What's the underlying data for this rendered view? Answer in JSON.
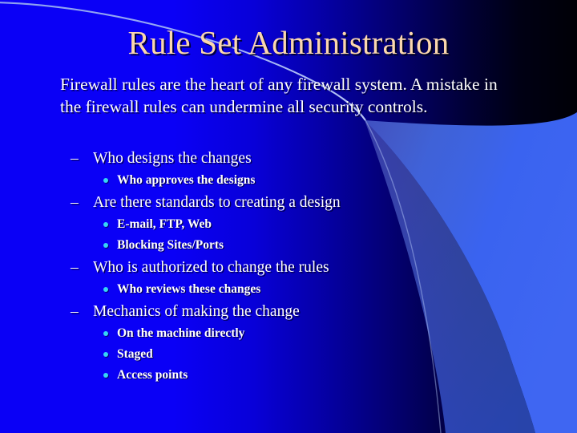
{
  "slide": {
    "title": "Rule Set Administration",
    "body_paragraph": "Firewall rules are the heart of any firewall system. A mistake in the firewall rules can undermine all security controls.",
    "level1_dash": "–",
    "bullets": [
      {
        "level": 1,
        "text": "Who designs the changes"
      },
      {
        "level": 2,
        "text": "Who approves the designs"
      },
      {
        "level": 1,
        "text": "Are there standards to creating a design"
      },
      {
        "level": 2,
        "text": "E-mail, FTP, Web"
      },
      {
        "level": 2,
        "text": "Blocking Sites/Ports"
      },
      {
        "level": 1,
        "text": "Who is authorized to change the rules"
      },
      {
        "level": 2,
        "text": "Who reviews these changes"
      },
      {
        "level": 1,
        "text": "Mechanics of making the change"
      },
      {
        "level": 2,
        "text": "On the machine directly"
      },
      {
        "level": 2,
        "text": "Staged"
      },
      {
        "level": 2,
        "text": "Access points"
      }
    ]
  },
  "theme": {
    "title_color": "#fbd7ae",
    "body_color": "#ffffff",
    "bullet_dot_color": "#35d6f5",
    "background_left": "#0a00f6",
    "background_right": "#000006",
    "accent_wedge_color": "#3a63f0",
    "accent_line_color": "#9fb4f2"
  }
}
